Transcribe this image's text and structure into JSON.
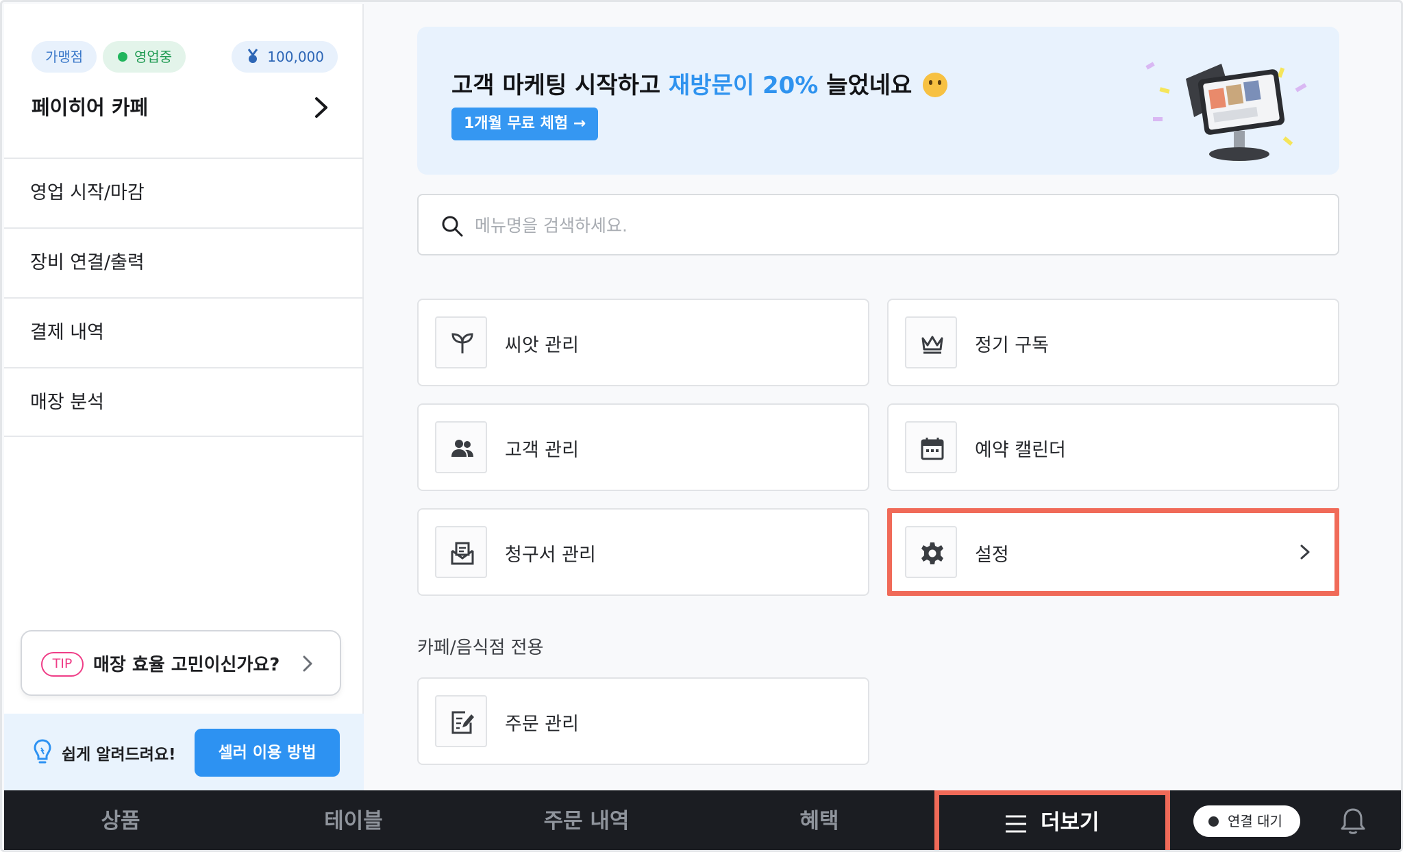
{
  "sidebar": {
    "chips": {
      "franchise": "가맹점",
      "status": "영업중",
      "points": "100,000"
    },
    "store_name": "페이히어 카페",
    "menu": [
      "영업 시작/마감",
      "장비 연결/출력",
      "결제 내역",
      "매장 분석"
    ],
    "tip": {
      "badge": "TIP",
      "text": "매장 효율 고민이신가요?"
    },
    "help": {
      "text": "쉽게 알려드려요!",
      "button": "셀러 이용 방법"
    }
  },
  "banner": {
    "title_part1": "고객 마케팅 시작하고 ",
    "title_highlight": "재방문이 20%",
    "title_part2": " 늘었네요",
    "button": "1개월 무료 체험 →"
  },
  "search": {
    "placeholder": "메뉴명을 검색하세요."
  },
  "tiles": [
    {
      "label": "씨앗 관리",
      "icon": "sprout-icon"
    },
    {
      "label": "정기 구독",
      "icon": "crown-icon"
    },
    {
      "label": "고객 관리",
      "icon": "people-icon"
    },
    {
      "label": "예약 캘린더",
      "icon": "calendar-icon"
    },
    {
      "label": "청구서 관리",
      "icon": "invoice-mail-icon"
    },
    {
      "label": "설정",
      "icon": "gear-icon"
    }
  ],
  "section": {
    "title": "카페/음식점 전용",
    "tiles": [
      {
        "label": "주문 관리",
        "icon": "order-edit-icon"
      }
    ]
  },
  "bottom_nav": {
    "items": [
      "상품",
      "테이블",
      "주문 내역",
      "혜택"
    ],
    "more": "더보기",
    "connection": "연결 대기"
  },
  "colors": {
    "accent_blue": "#2d92f2",
    "highlight_red": "#f06a58",
    "nav_bg": "#1b1d22",
    "status_green": "#20b55c",
    "tip_pink": "#ef3d87"
  }
}
